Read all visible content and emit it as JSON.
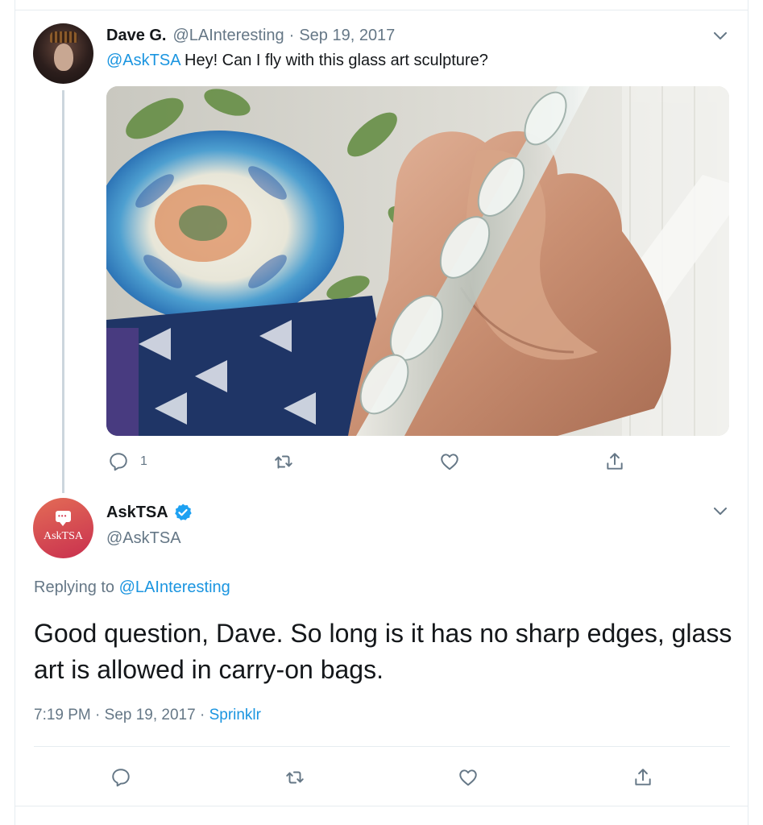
{
  "tweet1": {
    "author_name": "Dave G.",
    "author_handle": "@LAInteresting",
    "separator": "·",
    "date": "Sep 19, 2017",
    "mention": "@AskTSA",
    "text": "Hey! Can I fly with this glass art sculpture?",
    "reply_count": "1",
    "icons": [
      "reply-icon",
      "retweet-icon",
      "like-icon",
      "share-icon",
      "chevron-down-icon"
    ]
  },
  "tweet2": {
    "author_name": "AskTSA",
    "author_handle": "@AskTSA",
    "avatar_text": "AskTSA",
    "verified": true,
    "replying_prefix": "Replying to",
    "replying_to": "@LAInteresting",
    "text": "Good question, Dave. So long is it has no sharp edges, glass art is allowed in carry-on bags.",
    "time": "7:19 PM · Sep 19, 2017 · ",
    "source": "Sprinklr",
    "icons": [
      "reply-icon",
      "retweet-icon",
      "like-icon",
      "share-icon",
      "chevron-down-icon",
      "verified-badge-icon"
    ]
  },
  "colors": {
    "link": "#1b95e0",
    "secondary_text": "#657786",
    "primary_text": "#14171a",
    "border": "#e6ecf0",
    "thread_line": "#ccd6dd",
    "verified": "#1da1f2"
  }
}
